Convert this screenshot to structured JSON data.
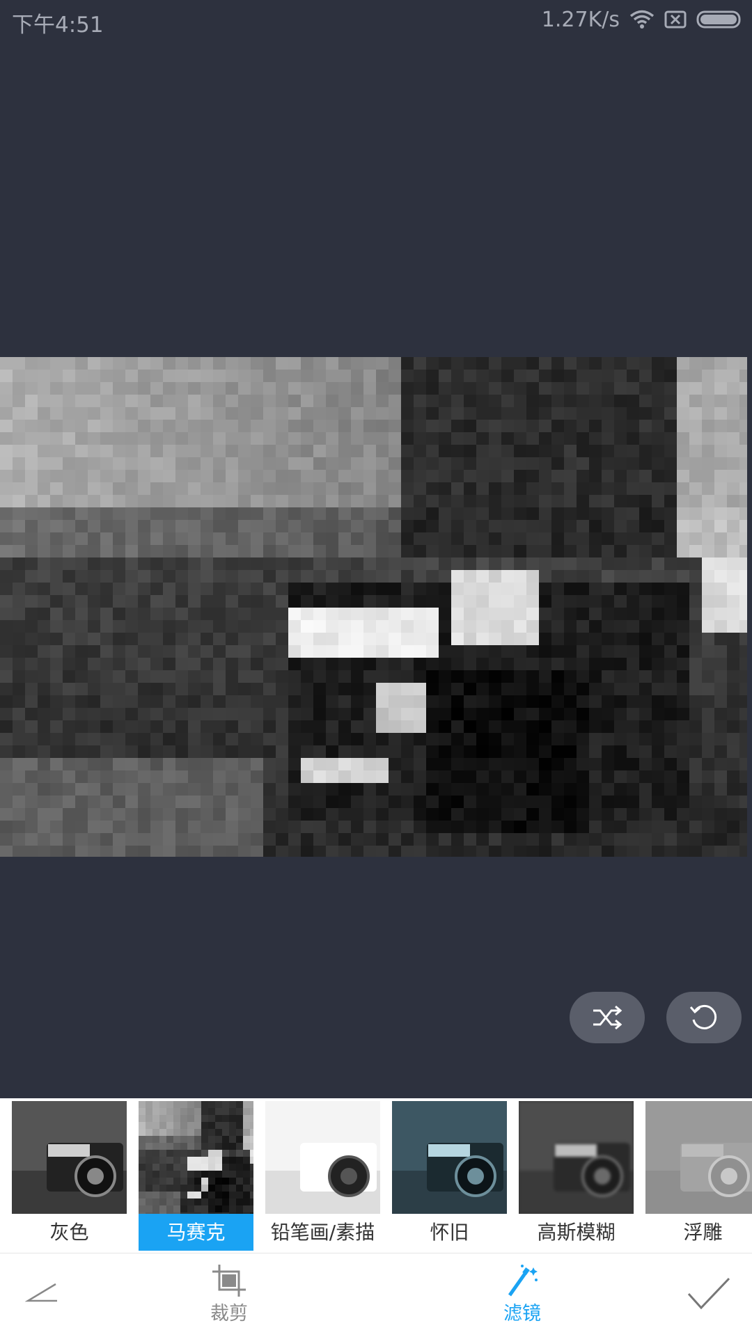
{
  "status_bar": {
    "time": "下午4:51",
    "net_speed": "1.27K/s",
    "icons": [
      "wifi-icon",
      "sim-x-icon",
      "battery-icon"
    ]
  },
  "editor": {
    "preview_filter": "马赛克",
    "actions": [
      {
        "name": "shuffle",
        "icon": "shuffle-icon"
      },
      {
        "name": "reset",
        "icon": "reset-icon"
      }
    ]
  },
  "filters": {
    "selected_index": 1,
    "items": [
      {
        "label": "灰色"
      },
      {
        "label": "马赛克"
      },
      {
        "label": "铅笔画/素描"
      },
      {
        "label": "怀旧"
      },
      {
        "label": "高斯模糊"
      },
      {
        "label": "浮雕"
      }
    ]
  },
  "toolbar": {
    "back_icon": "back-icon",
    "crop_label": "裁剪",
    "crop_icon": "crop-icon",
    "filter_label": "滤镜",
    "filter_icon": "magic-wand-icon",
    "confirm_icon": "check-icon"
  },
  "colors": {
    "background": "#2d313e",
    "accent": "#1aa3f3",
    "fab": "#5a5e6a"
  }
}
